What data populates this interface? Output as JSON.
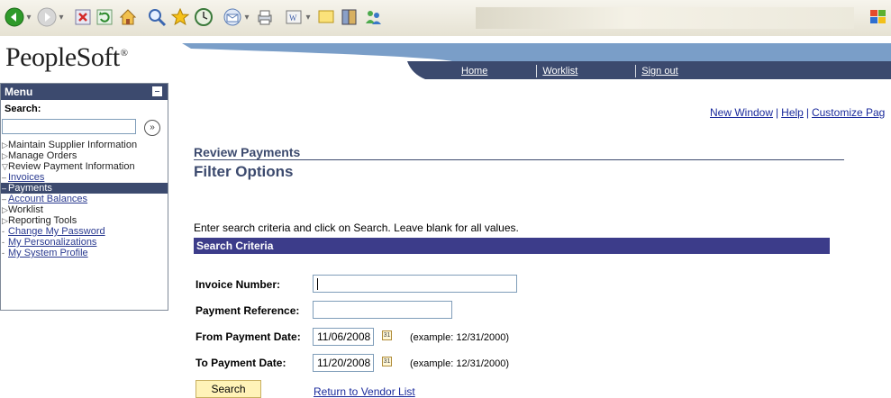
{
  "toolbar": {
    "icons": [
      "back-icon",
      "forward-icon",
      "stop-icon",
      "refresh-icon",
      "home-icon",
      "search-icon",
      "favorites-icon",
      "history-icon",
      "mail-icon",
      "print-icon",
      "edit-icon",
      "discuss-icon",
      "research-icon",
      "messenger-icon",
      "windows-logo-icon"
    ]
  },
  "brand": {
    "logo": "PeopleSoft",
    "logo_mark": "®"
  },
  "topnav": {
    "links": [
      "Home",
      "Worklist",
      "Sign out"
    ],
    "bar_color": "#3c4a6e",
    "accent_color": "#7a9ec8"
  },
  "menu": {
    "title": "Menu",
    "search_label": "Search:",
    "search_value": "",
    "items": [
      {
        "label": "Maintain Supplier Information"
      },
      {
        "label": "Manage Orders"
      },
      {
        "label": "Review Payment Information"
      },
      {
        "label": "Invoices"
      },
      {
        "label": "Payments"
      },
      {
        "label": "Account Balances"
      },
      {
        "label": "Worklist"
      },
      {
        "label": "Reporting Tools"
      },
      {
        "label": "Change My Password"
      },
      {
        "label": "My Personalizations"
      },
      {
        "label": "My System Profile"
      }
    ]
  },
  "page_links": {
    "new_window": "New Window",
    "help": "Help",
    "customize": "Customize Pag"
  },
  "page": {
    "breadcrumb": "Review Payments",
    "title": "Filter Options",
    "instructions": "Enter search criteria and click on Search. Leave blank for all values.",
    "section": "Search Criteria"
  },
  "form": {
    "invoice_label": "Invoice Number:",
    "invoice_value": "",
    "payment_ref_label": "Payment Reference:",
    "payment_ref_value": "",
    "from_label": "From Payment Date:",
    "from_value": "11/06/2008",
    "to_label": "To Payment Date:",
    "to_value": "11/20/2008",
    "date_example": "(example: 12/31/2000)",
    "calendar_glyph": "31",
    "search_button": "Search",
    "return_link": "Return to Vendor List"
  }
}
